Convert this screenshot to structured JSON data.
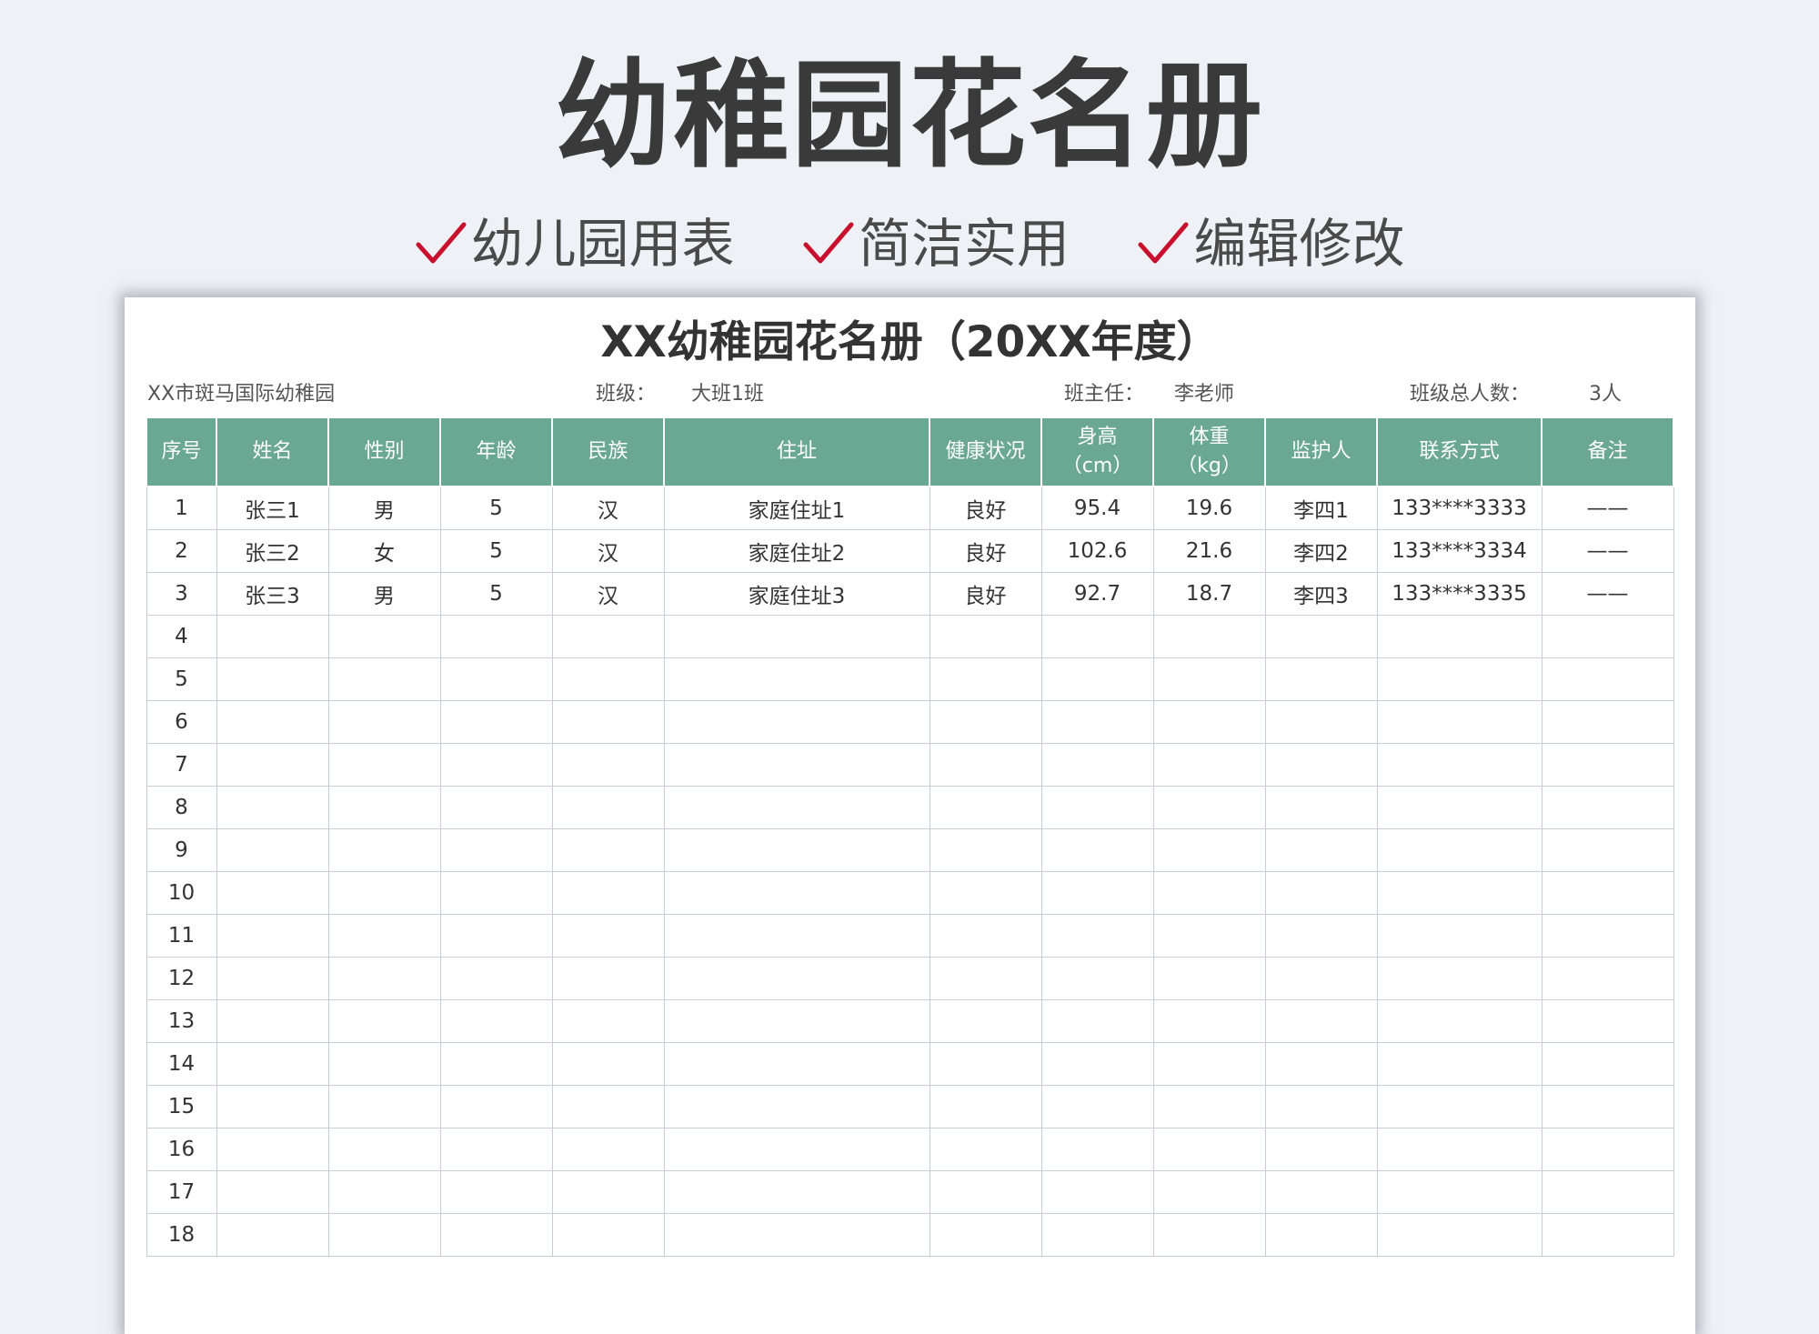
{
  "banner": {
    "title": "幼稚园花名册",
    "features": [
      "幼儿园用表",
      "简洁实用",
      "编辑修改"
    ],
    "check_color": "#c8102e"
  },
  "sheet": {
    "title": "XX幼稚园花名册（20XX年度）",
    "school": "XX市斑马国际幼稚园",
    "class_label": "班级：",
    "class_value": "大班1班",
    "teacher_label": "班主任：",
    "teacher_value": "李老师",
    "total_label": "班级总人数：",
    "total_value": "3人"
  },
  "table": {
    "header_color": "#6aa894",
    "headers": {
      "index": "序号",
      "name": "姓名",
      "gender": "性别",
      "age": "年龄",
      "ethnicity": "民族",
      "address": "住址",
      "health": "健康状况",
      "height": "身高",
      "height_unit": "（cm）",
      "weight": "体重",
      "weight_unit": "（kg）",
      "guardian": "监护人",
      "contact": "联系方式",
      "notes": "备注"
    },
    "rows": [
      {
        "index": "1",
        "name": "张三1",
        "gender": "男",
        "age": "5",
        "ethnicity": "汉",
        "address": "家庭住址1",
        "health": "良好",
        "height": "95.4",
        "weight": "19.6",
        "guardian": "李四1",
        "contact": "133****3333",
        "notes": "——"
      },
      {
        "index": "2",
        "name": "张三2",
        "gender": "女",
        "age": "5",
        "ethnicity": "汉",
        "address": "家庭住址2",
        "health": "良好",
        "height": "102.6",
        "weight": "21.6",
        "guardian": "李四2",
        "contact": "133****3334",
        "notes": "——"
      },
      {
        "index": "3",
        "name": "张三3",
        "gender": "男",
        "age": "5",
        "ethnicity": "汉",
        "address": "家庭住址3",
        "health": "良好",
        "height": "92.7",
        "weight": "18.7",
        "guardian": "李四3",
        "contact": "133****3335",
        "notes": "——"
      },
      {
        "index": "4",
        "name": "",
        "gender": "",
        "age": "",
        "ethnicity": "",
        "address": "",
        "health": "",
        "height": "",
        "weight": "",
        "guardian": "",
        "contact": "",
        "notes": ""
      },
      {
        "index": "5",
        "name": "",
        "gender": "",
        "age": "",
        "ethnicity": "",
        "address": "",
        "health": "",
        "height": "",
        "weight": "",
        "guardian": "",
        "contact": "",
        "notes": ""
      },
      {
        "index": "6",
        "name": "",
        "gender": "",
        "age": "",
        "ethnicity": "",
        "address": "",
        "health": "",
        "height": "",
        "weight": "",
        "guardian": "",
        "contact": "",
        "notes": ""
      },
      {
        "index": "7",
        "name": "",
        "gender": "",
        "age": "",
        "ethnicity": "",
        "address": "",
        "health": "",
        "height": "",
        "weight": "",
        "guardian": "",
        "contact": "",
        "notes": ""
      },
      {
        "index": "8",
        "name": "",
        "gender": "",
        "age": "",
        "ethnicity": "",
        "address": "",
        "health": "",
        "height": "",
        "weight": "",
        "guardian": "",
        "contact": "",
        "notes": ""
      },
      {
        "index": "9",
        "name": "",
        "gender": "",
        "age": "",
        "ethnicity": "",
        "address": "",
        "health": "",
        "height": "",
        "weight": "",
        "guardian": "",
        "contact": "",
        "notes": ""
      },
      {
        "index": "10",
        "name": "",
        "gender": "",
        "age": "",
        "ethnicity": "",
        "address": "",
        "health": "",
        "height": "",
        "weight": "",
        "guardian": "",
        "contact": "",
        "notes": ""
      },
      {
        "index": "11",
        "name": "",
        "gender": "",
        "age": "",
        "ethnicity": "",
        "address": "",
        "health": "",
        "height": "",
        "weight": "",
        "guardian": "",
        "contact": "",
        "notes": ""
      },
      {
        "index": "12",
        "name": "",
        "gender": "",
        "age": "",
        "ethnicity": "",
        "address": "",
        "health": "",
        "height": "",
        "weight": "",
        "guardian": "",
        "contact": "",
        "notes": ""
      },
      {
        "index": "13",
        "name": "",
        "gender": "",
        "age": "",
        "ethnicity": "",
        "address": "",
        "health": "",
        "height": "",
        "weight": "",
        "guardian": "",
        "contact": "",
        "notes": ""
      },
      {
        "index": "14",
        "name": "",
        "gender": "",
        "age": "",
        "ethnicity": "",
        "address": "",
        "health": "",
        "height": "",
        "weight": "",
        "guardian": "",
        "contact": "",
        "notes": ""
      },
      {
        "index": "15",
        "name": "",
        "gender": "",
        "age": "",
        "ethnicity": "",
        "address": "",
        "health": "",
        "height": "",
        "weight": "",
        "guardian": "",
        "contact": "",
        "notes": ""
      },
      {
        "index": "16",
        "name": "",
        "gender": "",
        "age": "",
        "ethnicity": "",
        "address": "",
        "health": "",
        "height": "",
        "weight": "",
        "guardian": "",
        "contact": "",
        "notes": ""
      },
      {
        "index": "17",
        "name": "",
        "gender": "",
        "age": "",
        "ethnicity": "",
        "address": "",
        "health": "",
        "height": "",
        "weight": "",
        "guardian": "",
        "contact": "",
        "notes": ""
      },
      {
        "index": "18",
        "name": "",
        "gender": "",
        "age": "",
        "ethnicity": "",
        "address": "",
        "health": "",
        "height": "",
        "weight": "",
        "guardian": "",
        "contact": "",
        "notes": ""
      }
    ]
  }
}
